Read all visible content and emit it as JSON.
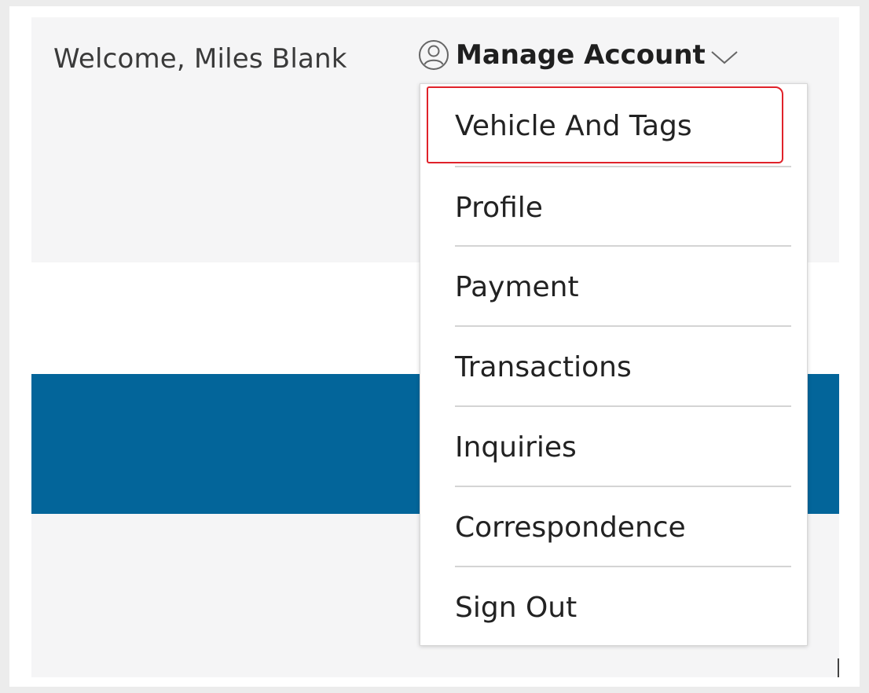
{
  "header": {
    "welcome_text": "Welcome, Miles Blank",
    "manage_account_label": "Manage Account"
  },
  "menu": {
    "items": [
      {
        "label": "Vehicle And Tags",
        "highlighted": true
      },
      {
        "label": "Profile"
      },
      {
        "label": "Payment"
      },
      {
        "label": "Transactions"
      },
      {
        "label": "Inquiries"
      },
      {
        "label": "Correspondence"
      },
      {
        "label": "Sign Out"
      }
    ]
  },
  "colors": {
    "accent_blue": "#03659a",
    "highlight_red": "#e0222a"
  },
  "icons": {
    "account": "user-circle-icon",
    "expand": "chevron-down-icon"
  }
}
